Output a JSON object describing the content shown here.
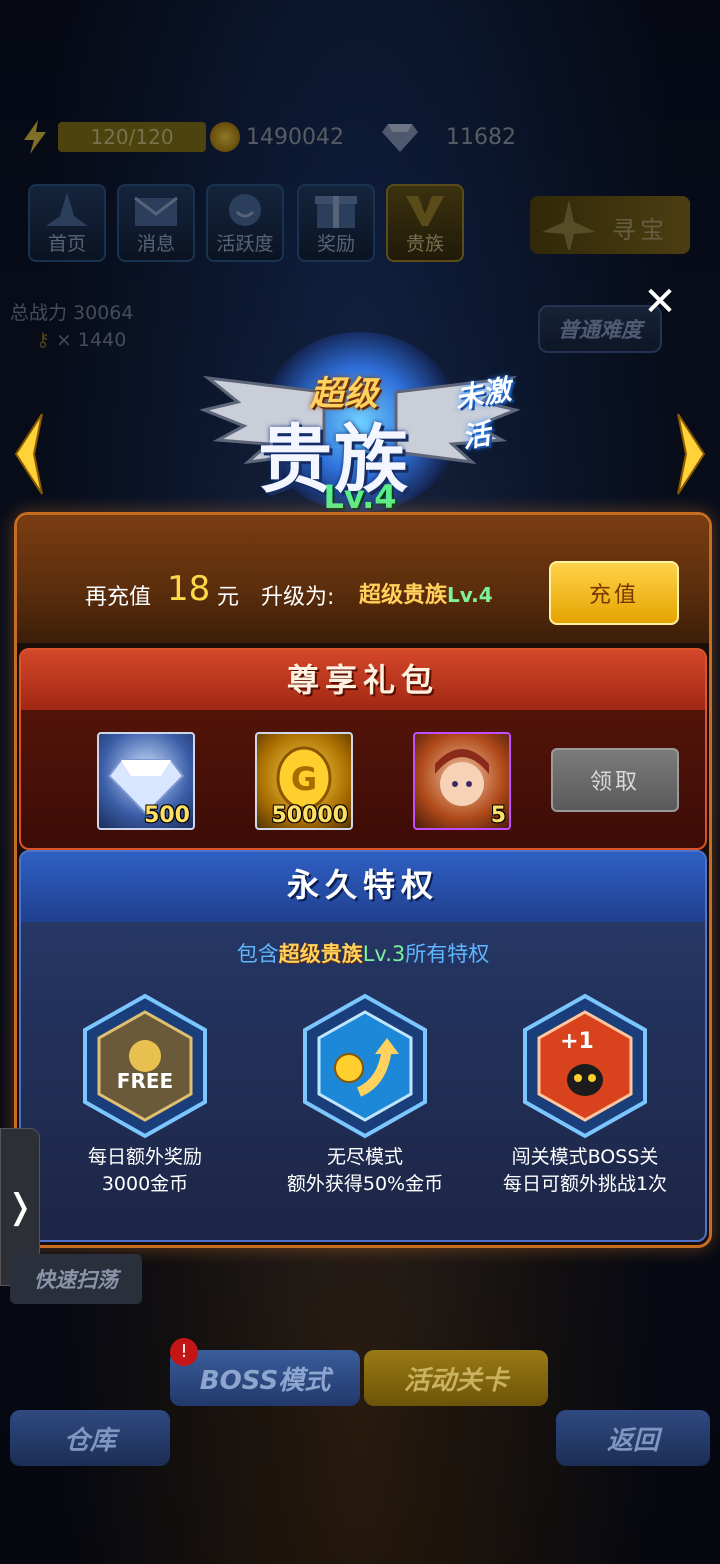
{
  "resources": {
    "energy": "120/120",
    "gold": "1490042",
    "gems": "11682"
  },
  "nav": {
    "items": [
      {
        "label": "首页"
      },
      {
        "label": "消息"
      },
      {
        "label": "活跃度"
      },
      {
        "label": "奖励"
      },
      {
        "label": "贵族"
      }
    ],
    "treasure": "寻宝"
  },
  "status": {
    "power_label": "总战力 30064",
    "keys": "× 1440",
    "difficulty": "普通难度"
  },
  "emblem": {
    "small_title": "超级",
    "big_title": "贵族",
    "level": "Lv.4",
    "state": "未激活"
  },
  "recharge": {
    "prefix": "再充值",
    "amount": "18",
    "unit": "元",
    "upgrade_label": "升级为:",
    "target_name": "超级贵族",
    "target_level": "Lv.4",
    "button": "充值"
  },
  "gift": {
    "title": "尊享礼包",
    "items": [
      {
        "name": "diamond",
        "qty": "500"
      },
      {
        "name": "gold-coin",
        "qty": "50000"
      },
      {
        "name": "hero-card",
        "qty": "5"
      }
    ],
    "claim_button": "领取"
  },
  "privilege": {
    "title": "永久特权",
    "sub_prefix": "包含",
    "sub_highlight": "超级贵族",
    "sub_level": "Lv.3",
    "sub_suffix": "所有特权",
    "free_label": "FREE",
    "plus_label": "+1",
    "benefits": [
      {
        "line1": "每日额外奖励",
        "line2": "3000金币"
      },
      {
        "line1": "无尽模式",
        "line2": "额外获得50%金币"
      },
      {
        "line1": "闯关模式BOSS关",
        "line2": "每日可额外挑战1次"
      }
    ]
  },
  "bottom": {
    "quick_sweep": "快速扫荡",
    "boss_mode": "BOSS模式",
    "event_stage": "活动关卡",
    "warehouse": "仓库",
    "back": "返回",
    "alert": "!"
  },
  "colors": {
    "accent_gold": "#ffd25e",
    "accent_green": "#7cf29b",
    "panel_border": "#c66d21",
    "privilege_blue": "#4e73c9"
  }
}
